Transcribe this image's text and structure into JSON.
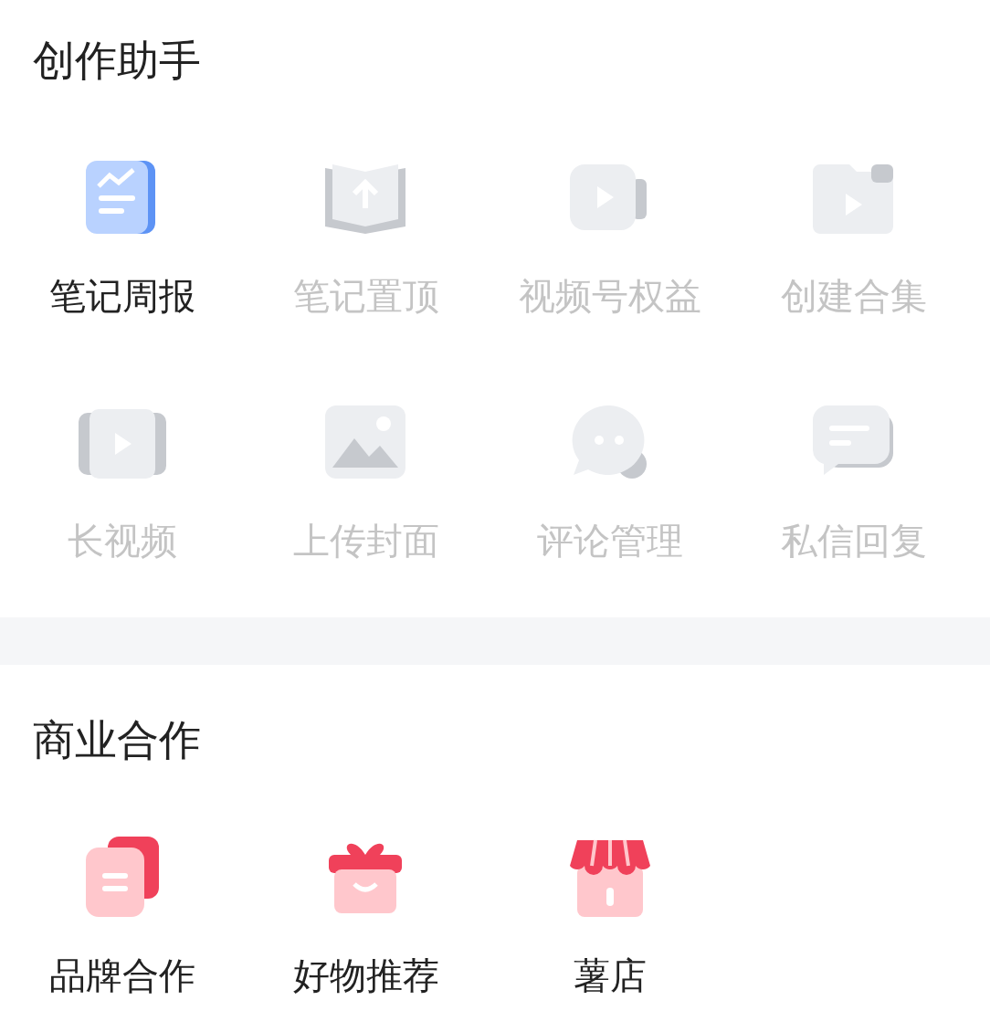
{
  "sections": [
    {
      "title": "创作助手",
      "items": [
        {
          "label": "笔记周报",
          "disabled": false
        },
        {
          "label": "笔记置顶",
          "disabled": true
        },
        {
          "label": "视频号权益",
          "disabled": true
        },
        {
          "label": "创建合集",
          "disabled": true
        },
        {
          "label": "长视频",
          "disabled": true
        },
        {
          "label": "上传封面",
          "disabled": true
        },
        {
          "label": "评论管理",
          "disabled": true
        },
        {
          "label": "私信回复",
          "disabled": true
        }
      ]
    },
    {
      "title": "商业合作",
      "items": [
        {
          "label": "品牌合作",
          "disabled": false
        },
        {
          "label": "好物推荐",
          "disabled": false
        },
        {
          "label": "薯店",
          "disabled": false
        }
      ]
    }
  ]
}
